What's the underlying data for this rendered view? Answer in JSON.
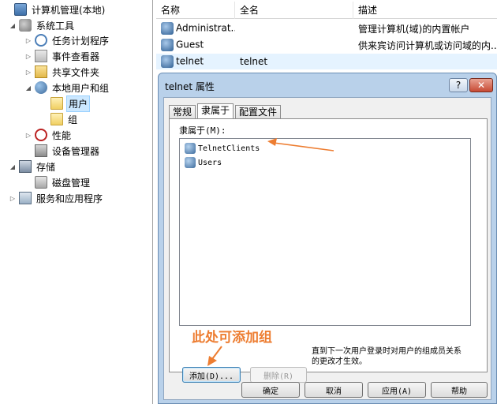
{
  "tree": {
    "items": [
      {
        "label": "计算机管理(本地)",
        "icon": "computer-icon",
        "expander": ""
      },
      {
        "label": "系统工具",
        "icon": "tools-icon",
        "expander": "◢"
      },
      {
        "label": "任务计划程序",
        "icon": "clock-icon",
        "expander": "▷"
      },
      {
        "label": "事件查看器",
        "icon": "event-viewer-icon",
        "expander": "▷"
      },
      {
        "label": "共享文件夹",
        "icon": "shared-folder-icon",
        "expander": "▷"
      },
      {
        "label": "本地用户和组",
        "icon": "users-icon",
        "expander": "◢"
      },
      {
        "label": "用户",
        "icon": "folder-icon",
        "expander": ""
      },
      {
        "label": "组",
        "icon": "folder-icon",
        "expander": ""
      },
      {
        "label": "性能",
        "icon": "performance-icon",
        "expander": "▷"
      },
      {
        "label": "设备管理器",
        "icon": "device-manager-icon",
        "expander": ""
      },
      {
        "label": "存储",
        "icon": "storage-icon",
        "expander": "◢"
      },
      {
        "label": "磁盘管理",
        "icon": "disk-icon",
        "expander": ""
      },
      {
        "label": "服务和应用程序",
        "icon": "services-icon",
        "expander": "▷"
      }
    ]
  },
  "list": {
    "columns": [
      "名称",
      "全名",
      "描述"
    ],
    "rows": [
      {
        "name": "Administrat...",
        "full_name": "",
        "description": "管理计算机(域)的内置帐户"
      },
      {
        "name": "Guest",
        "full_name": "",
        "description": "供来宾访问计算机或访问域的内..."
      },
      {
        "name": "telnet",
        "full_name": "telnet",
        "description": ""
      }
    ]
  },
  "dialog": {
    "title": "telnet 属性",
    "help_label": "?",
    "close_label": "✕",
    "tabs": [
      "常规",
      "隶属于",
      "配置文件"
    ],
    "active_tab": "隶属于",
    "member_of_label": "隶属于(M):",
    "members": [
      "TelnetClients",
      "Users"
    ],
    "annotation": "此处可添加组",
    "add_label": "添加(D)...",
    "remove_label": "删除(R)",
    "note": "直到下一次用户登录时对用户的组成员关系的更改才生效。",
    "ok_label": "确定",
    "cancel_label": "取消",
    "apply_label": "应用(A)",
    "help_button_label": "帮助"
  },
  "colors": {
    "annotation": "#ed7d31",
    "selection": "#cce8ff",
    "dialog_frame": "#b9d1ea"
  }
}
